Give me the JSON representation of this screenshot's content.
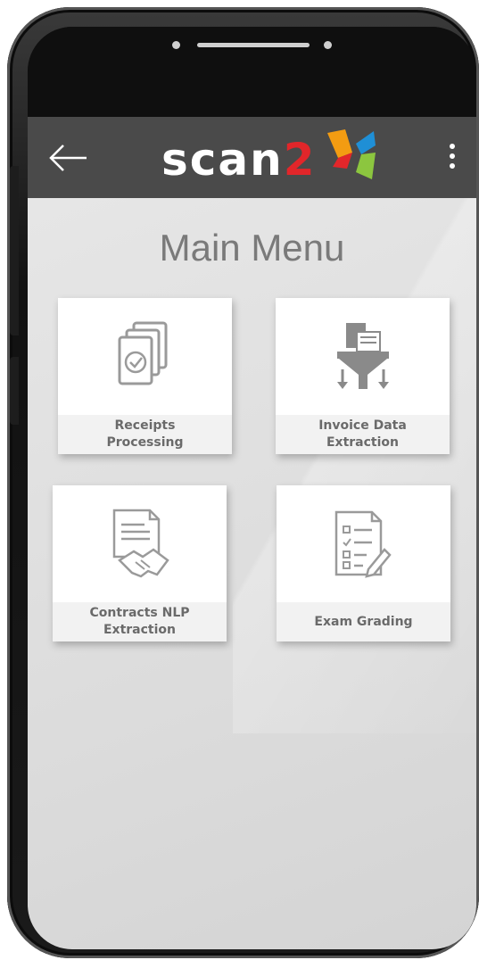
{
  "app": {
    "logo_text_main": "scan",
    "logo_text_accent": "2"
  },
  "main": {
    "title": "Main Menu",
    "cards": [
      {
        "label": "Receipts\nProcessing",
        "icon": "receipts-icon"
      },
      {
        "label": "Invoice Data\nExtraction",
        "icon": "funnel-icon"
      },
      {
        "label": "Contracts NLP\nExtraction",
        "icon": "contract-handshake-icon"
      },
      {
        "label": "Exam Grading",
        "icon": "exam-checklist-icon"
      }
    ]
  },
  "icons": {
    "back": "arrow-left-icon",
    "menu": "kebab-menu-icon"
  },
  "colors": {
    "appbar": "#4a4a4a",
    "logo_red": "#e2262a",
    "logo_orange": "#f39c12",
    "logo_blue": "#1f8fd6",
    "logo_green": "#8cc63f",
    "icon_gray": "#9a9a9a"
  }
}
